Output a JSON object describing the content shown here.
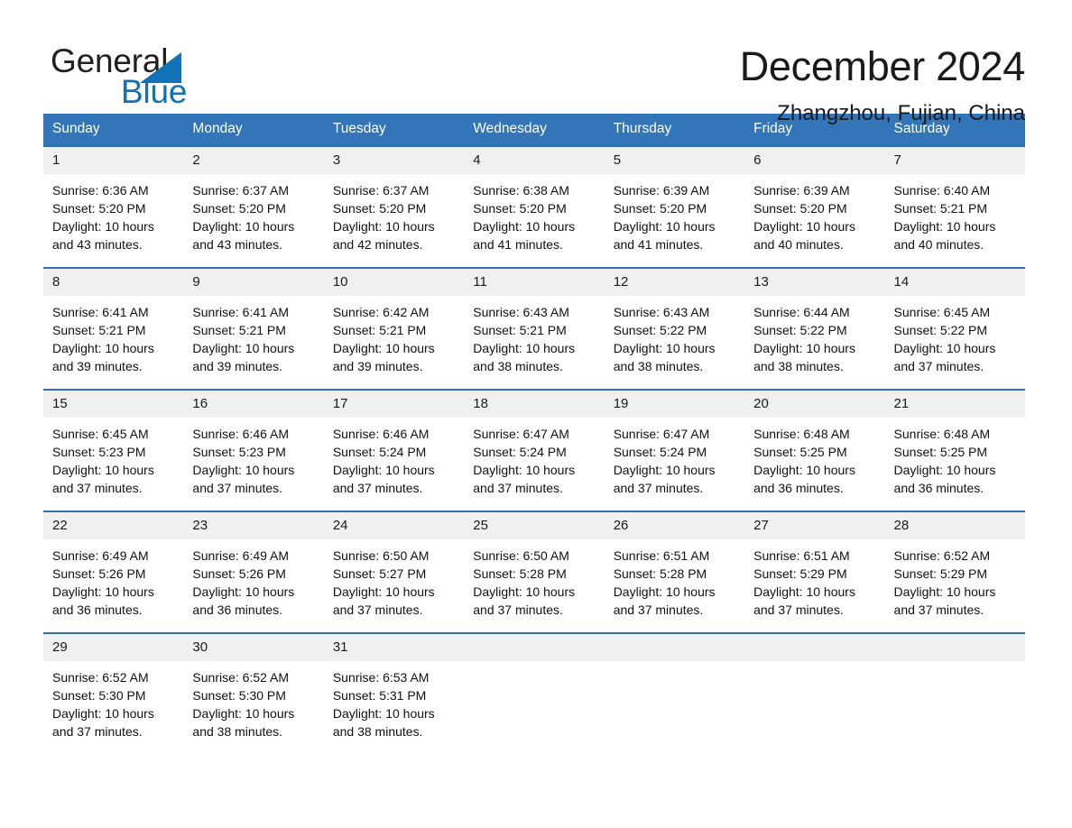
{
  "brand": {
    "name_part1": "General",
    "name_part2": "Blue",
    "logo_icon": "triangle-logo",
    "accent_color": "#1272b6"
  },
  "header": {
    "month_title": "December 2024",
    "location": "Zhangzhou, Fujian, China"
  },
  "calendar": {
    "header_background": "#3275b8",
    "daynum_background": "#f0f0f0",
    "weekdays": [
      "Sunday",
      "Monday",
      "Tuesday",
      "Wednesday",
      "Thursday",
      "Friday",
      "Saturday"
    ],
    "weeks": [
      [
        {
          "day": "1",
          "sunrise": "Sunrise: 6:36 AM",
          "sunset": "Sunset: 5:20 PM",
          "daylight_line1": "Daylight: 10 hours",
          "daylight_line2": "and 43 minutes."
        },
        {
          "day": "2",
          "sunrise": "Sunrise: 6:37 AM",
          "sunset": "Sunset: 5:20 PM",
          "daylight_line1": "Daylight: 10 hours",
          "daylight_line2": "and 43 minutes."
        },
        {
          "day": "3",
          "sunrise": "Sunrise: 6:37 AM",
          "sunset": "Sunset: 5:20 PM",
          "daylight_line1": "Daylight: 10 hours",
          "daylight_line2": "and 42 minutes."
        },
        {
          "day": "4",
          "sunrise": "Sunrise: 6:38 AM",
          "sunset": "Sunset: 5:20 PM",
          "daylight_line1": "Daylight: 10 hours",
          "daylight_line2": "and 41 minutes."
        },
        {
          "day": "5",
          "sunrise": "Sunrise: 6:39 AM",
          "sunset": "Sunset: 5:20 PM",
          "daylight_line1": "Daylight: 10 hours",
          "daylight_line2": "and 41 minutes."
        },
        {
          "day": "6",
          "sunrise": "Sunrise: 6:39 AM",
          "sunset": "Sunset: 5:20 PM",
          "daylight_line1": "Daylight: 10 hours",
          "daylight_line2": "and 40 minutes."
        },
        {
          "day": "7",
          "sunrise": "Sunrise: 6:40 AM",
          "sunset": "Sunset: 5:21 PM",
          "daylight_line1": "Daylight: 10 hours",
          "daylight_line2": "and 40 minutes."
        }
      ],
      [
        {
          "day": "8",
          "sunrise": "Sunrise: 6:41 AM",
          "sunset": "Sunset: 5:21 PM",
          "daylight_line1": "Daylight: 10 hours",
          "daylight_line2": "and 39 minutes."
        },
        {
          "day": "9",
          "sunrise": "Sunrise: 6:41 AM",
          "sunset": "Sunset: 5:21 PM",
          "daylight_line1": "Daylight: 10 hours",
          "daylight_line2": "and 39 minutes."
        },
        {
          "day": "10",
          "sunrise": "Sunrise: 6:42 AM",
          "sunset": "Sunset: 5:21 PM",
          "daylight_line1": "Daylight: 10 hours",
          "daylight_line2": "and 39 minutes."
        },
        {
          "day": "11",
          "sunrise": "Sunrise: 6:43 AM",
          "sunset": "Sunset: 5:21 PM",
          "daylight_line1": "Daylight: 10 hours",
          "daylight_line2": "and 38 minutes."
        },
        {
          "day": "12",
          "sunrise": "Sunrise: 6:43 AM",
          "sunset": "Sunset: 5:22 PM",
          "daylight_line1": "Daylight: 10 hours",
          "daylight_line2": "and 38 minutes."
        },
        {
          "day": "13",
          "sunrise": "Sunrise: 6:44 AM",
          "sunset": "Sunset: 5:22 PM",
          "daylight_line1": "Daylight: 10 hours",
          "daylight_line2": "and 38 minutes."
        },
        {
          "day": "14",
          "sunrise": "Sunrise: 6:45 AM",
          "sunset": "Sunset: 5:22 PM",
          "daylight_line1": "Daylight: 10 hours",
          "daylight_line2": "and 37 minutes."
        }
      ],
      [
        {
          "day": "15",
          "sunrise": "Sunrise: 6:45 AM",
          "sunset": "Sunset: 5:23 PM",
          "daylight_line1": "Daylight: 10 hours",
          "daylight_line2": "and 37 minutes."
        },
        {
          "day": "16",
          "sunrise": "Sunrise: 6:46 AM",
          "sunset": "Sunset: 5:23 PM",
          "daylight_line1": "Daylight: 10 hours",
          "daylight_line2": "and 37 minutes."
        },
        {
          "day": "17",
          "sunrise": "Sunrise: 6:46 AM",
          "sunset": "Sunset: 5:24 PM",
          "daylight_line1": "Daylight: 10 hours",
          "daylight_line2": "and 37 minutes."
        },
        {
          "day": "18",
          "sunrise": "Sunrise: 6:47 AM",
          "sunset": "Sunset: 5:24 PM",
          "daylight_line1": "Daylight: 10 hours",
          "daylight_line2": "and 37 minutes."
        },
        {
          "day": "19",
          "sunrise": "Sunrise: 6:47 AM",
          "sunset": "Sunset: 5:24 PM",
          "daylight_line1": "Daylight: 10 hours",
          "daylight_line2": "and 37 minutes."
        },
        {
          "day": "20",
          "sunrise": "Sunrise: 6:48 AM",
          "sunset": "Sunset: 5:25 PM",
          "daylight_line1": "Daylight: 10 hours",
          "daylight_line2": "and 36 minutes."
        },
        {
          "day": "21",
          "sunrise": "Sunrise: 6:48 AM",
          "sunset": "Sunset: 5:25 PM",
          "daylight_line1": "Daylight: 10 hours",
          "daylight_line2": "and 36 minutes."
        }
      ],
      [
        {
          "day": "22",
          "sunrise": "Sunrise: 6:49 AM",
          "sunset": "Sunset: 5:26 PM",
          "daylight_line1": "Daylight: 10 hours",
          "daylight_line2": "and 36 minutes."
        },
        {
          "day": "23",
          "sunrise": "Sunrise: 6:49 AM",
          "sunset": "Sunset: 5:26 PM",
          "daylight_line1": "Daylight: 10 hours",
          "daylight_line2": "and 36 minutes."
        },
        {
          "day": "24",
          "sunrise": "Sunrise: 6:50 AM",
          "sunset": "Sunset: 5:27 PM",
          "daylight_line1": "Daylight: 10 hours",
          "daylight_line2": "and 37 minutes."
        },
        {
          "day": "25",
          "sunrise": "Sunrise: 6:50 AM",
          "sunset": "Sunset: 5:28 PM",
          "daylight_line1": "Daylight: 10 hours",
          "daylight_line2": "and 37 minutes."
        },
        {
          "day": "26",
          "sunrise": "Sunrise: 6:51 AM",
          "sunset": "Sunset: 5:28 PM",
          "daylight_line1": "Daylight: 10 hours",
          "daylight_line2": "and 37 minutes."
        },
        {
          "day": "27",
          "sunrise": "Sunrise: 6:51 AM",
          "sunset": "Sunset: 5:29 PM",
          "daylight_line1": "Daylight: 10 hours",
          "daylight_line2": "and 37 minutes."
        },
        {
          "day": "28",
          "sunrise": "Sunrise: 6:52 AM",
          "sunset": "Sunset: 5:29 PM",
          "daylight_line1": "Daylight: 10 hours",
          "daylight_line2": "and 37 minutes."
        }
      ],
      [
        {
          "day": "29",
          "sunrise": "Sunrise: 6:52 AM",
          "sunset": "Sunset: 5:30 PM",
          "daylight_line1": "Daylight: 10 hours",
          "daylight_line2": "and 37 minutes."
        },
        {
          "day": "30",
          "sunrise": "Sunrise: 6:52 AM",
          "sunset": "Sunset: 5:30 PM",
          "daylight_line1": "Daylight: 10 hours",
          "daylight_line2": "and 38 minutes."
        },
        {
          "day": "31",
          "sunrise": "Sunrise: 6:53 AM",
          "sunset": "Sunset: 5:31 PM",
          "daylight_line1": "Daylight: 10 hours",
          "daylight_line2": "and 38 minutes."
        },
        null,
        null,
        null,
        null
      ]
    ]
  }
}
